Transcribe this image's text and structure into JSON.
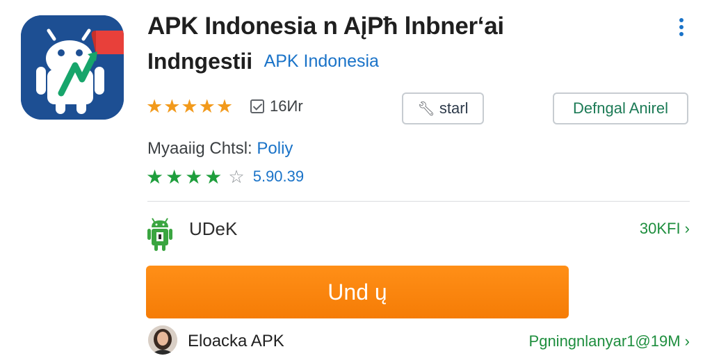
{
  "app": {
    "title": "APK Indonesia n AįPħ lnbnerʻai",
    "subtitle": "Indngestii",
    "developer_link": "APK Indonesia",
    "icon": "android-robot-app-icon",
    "accent_color": "#1d4f93"
  },
  "menu": {
    "icon": "kebab-menu-icon"
  },
  "rating": {
    "stars": 5,
    "review_count": "16Иr"
  },
  "actions": {
    "start_label": "starl",
    "start_icon": "wrench-icon",
    "default_label": "Defngal Anirel"
  },
  "meta": {
    "label": "Myaaiig Chtsl:",
    "value": "Poliy"
  },
  "rating2": {
    "filled_stars": 4,
    "total_stars": 5,
    "score": "5.90.39"
  },
  "update": {
    "icon": "android-update-icon",
    "label": "UDeK",
    "size": "30KFI ›"
  },
  "primary_button": {
    "label": "Und ų",
    "color": "#f5840b"
  },
  "developer": {
    "avatar": "avatar-portrait",
    "name": "Eloacka APK",
    "link": "Pgningnlanyar1@19M ›"
  }
}
